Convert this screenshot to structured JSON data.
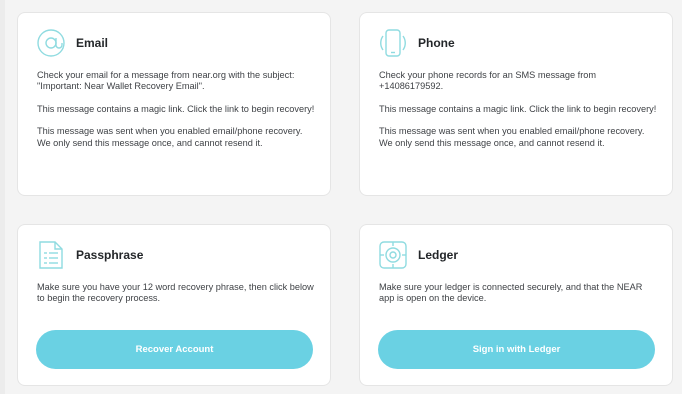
{
  "colors": {
    "accent": "#6ad1e3",
    "icon_stroke": "#8fdbe0",
    "card_background": "#ffffff",
    "page_background": "#f4f4f4"
  },
  "cards": {
    "email": {
      "icon": "at-sign-icon",
      "title": "Email",
      "paragraphs": [
        "Check your email for a message from near.org with the subject: \"Important: Near Wallet Recovery Email\".",
        "This message contains a magic link. Click the link to begin recovery!",
        "This message was sent when you enabled email/phone recovery. We only send this message once, and cannot resend it."
      ]
    },
    "phone": {
      "icon": "phone-icon",
      "title": "Phone",
      "paragraphs": [
        "Check your phone records for an SMS message from +14086179592.",
        "This message contains a magic link. Click the link to begin recovery!",
        "This message was sent when you enabled email/phone recovery. We only send this message once, and cannot resend it."
      ]
    },
    "passphrase": {
      "icon": "document-list-icon",
      "title": "Passphrase",
      "paragraphs": [
        "Make sure you have your 12 word recovery phrase, then click below to begin the recovery process."
      ],
      "button_label": "Recover Account"
    },
    "ledger": {
      "icon": "ledger-device-icon",
      "title": "Ledger",
      "paragraphs": [
        "Make sure your ledger is connected securely, and that the NEAR app is open on the device."
      ],
      "button_label": "Sign in with Ledger"
    }
  }
}
